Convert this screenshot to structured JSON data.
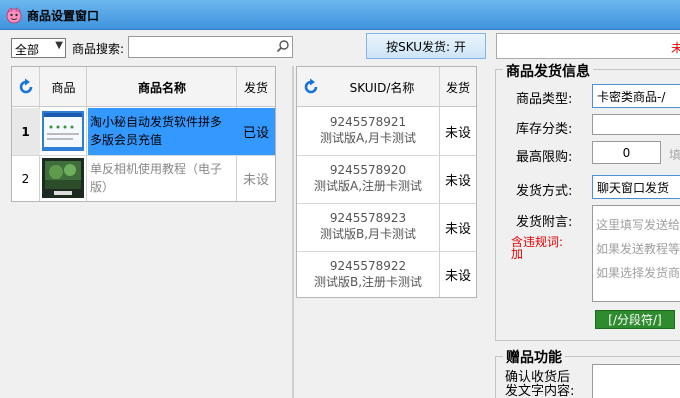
{
  "window": {
    "title": "商品设置窗口"
  },
  "toolbar": {
    "category_value": "全部",
    "search_label": "商品搜索:",
    "search_value": "",
    "sku_button_label": "按SKU发货: 开",
    "status_text": "未"
  },
  "product_table": {
    "columns": [
      "商品",
      "商品名称",
      "发货"
    ],
    "rows": [
      {
        "index": "1",
        "name_line1": "淘小秘自动发货软件拼多",
        "name_line2": "多版会员充值",
        "ship": "已设"
      },
      {
        "index": "2",
        "name_line1": "单反相机使用教程（电子",
        "name_line2": "版）",
        "ship": "未设"
      }
    ]
  },
  "sku_table": {
    "columns": [
      "SKUID/名称",
      "发货"
    ],
    "rows": [
      {
        "id": "9245578921",
        "name": "测试版A,月卡测试",
        "ship": "未设"
      },
      {
        "id": "9245578920",
        "name": "测试版A,注册卡测试",
        "ship": "未设"
      },
      {
        "id": "9245578923",
        "name": "测试版B,月卡测试",
        "ship": "未设"
      },
      {
        "id": "9245578922",
        "name": "测试版B,注册卡测试",
        "ship": "未设"
      }
    ]
  },
  "delivery": {
    "section_title": "商品发货信息",
    "type_label": "商品类型:",
    "type_value": "卡密类商品-/",
    "stock_label": "库存分类:",
    "stock_value": "",
    "limit_label": "最高限购:",
    "limit_value": "0",
    "limit_hint": "填",
    "method_label": "发货方式:",
    "method_value": "聊天窗口发货",
    "note_label": "发货附言:",
    "violation_label_line1": "含违规词:",
    "violation_label_line2": "加",
    "note_placeholder_1": "这里填写发送给",
    "note_placeholder_2": "如果发送教程等",
    "note_placeholder_3": "如果选择发货商",
    "segment_button": "[/分段符/]"
  },
  "gift": {
    "section_title": "赠品功能",
    "confirm_label_line1": "确认收货后",
    "confirm_label_line2": "发文字内容:"
  }
}
